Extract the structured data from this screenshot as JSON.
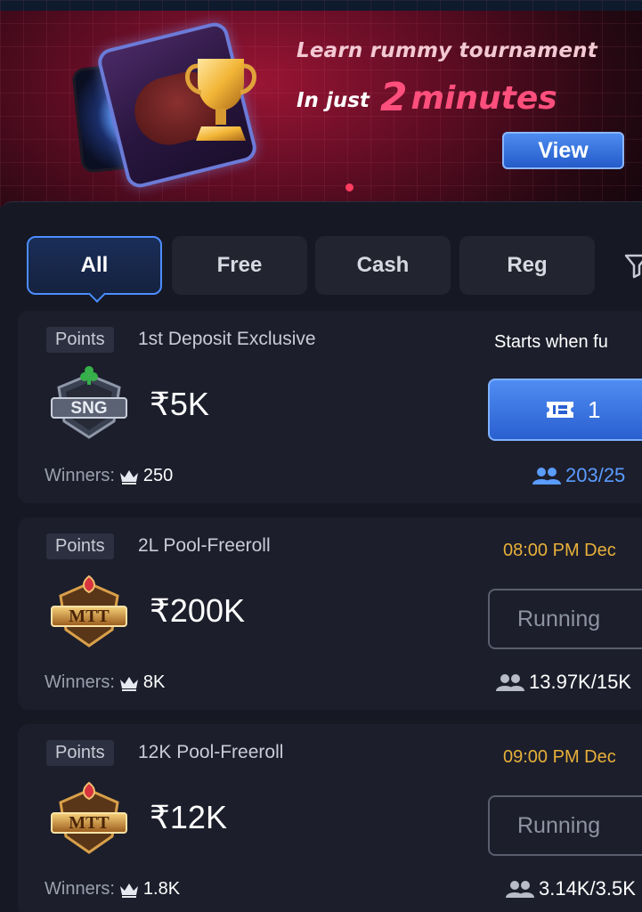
{
  "banner": {
    "line1": "Learn rummy tournament",
    "line2_prefix": "In just",
    "line2_number": "2",
    "line2_suffix": "minutes",
    "view_label": "View"
  },
  "tabs": [
    {
      "label": "All",
      "active": true
    },
    {
      "label": "Free",
      "active": false
    },
    {
      "label": "Cash",
      "active": false
    },
    {
      "label": "Reg",
      "active": false
    }
  ],
  "tournaments": [
    {
      "tag": "Points",
      "name": "1st Deposit Exclusive",
      "badge": "SNG",
      "prize": "₹5K",
      "winners_label": "Winners:",
      "winners": "250",
      "status_text": "Starts when fu",
      "action": "join",
      "ticket_count": "1",
      "players": "203/25"
    },
    {
      "tag": "Points",
      "name": "2L Pool-Freeroll",
      "badge": "MTT",
      "prize": "₹200K",
      "winners_label": "Winners:",
      "winners": "8K",
      "status_text": "08:00 PM Dec",
      "action": "Running",
      "players": "13.97K/15K"
    },
    {
      "tag": "Points",
      "name": "12K Pool-Freeroll",
      "badge": "MTT",
      "prize": "₹12K",
      "winners_label": "Winners:",
      "winners": "1.8K",
      "status_text": "09:00 PM Dec",
      "action": "Running",
      "players": "3.14K/3.5K"
    }
  ],
  "colors": {
    "accent_blue": "#4c8dff",
    "time_orange": "#e8b03a",
    "banner_pink": "#ff4f7d"
  }
}
